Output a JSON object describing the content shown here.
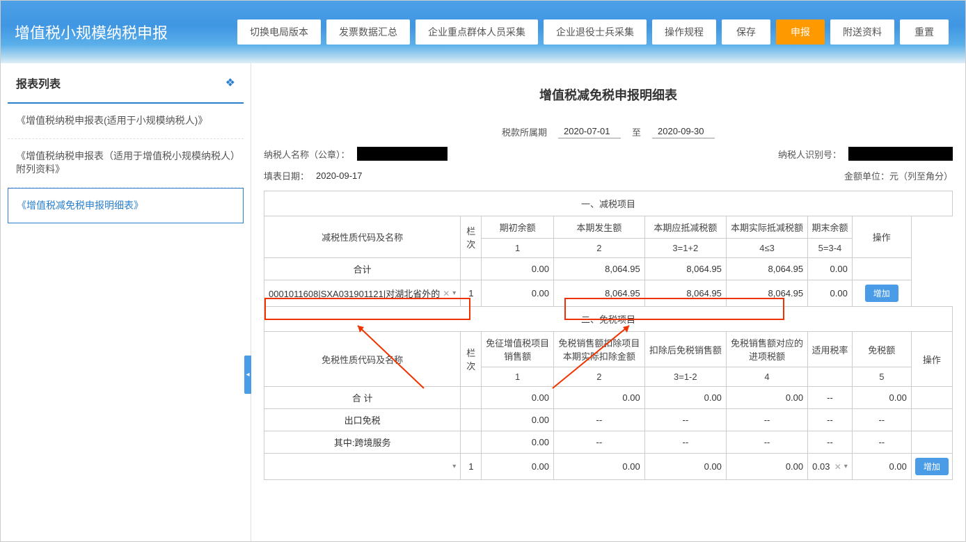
{
  "app": {
    "title": "增值税小规模纳税申报"
  },
  "toolbar": {
    "switch_version": "切换电局版本",
    "invoice_summary": "发票数据汇总",
    "key_groups": "企业重点群体人员采集",
    "retired_soldier": "企业退役士兵采集",
    "procedure": "操作规程",
    "save": "保存",
    "declare": "申报",
    "attachments": "附送资料",
    "reset": "重置"
  },
  "sidebar": {
    "title": "报表列表",
    "items": [
      {
        "label": "《增值税纳税申报表(适用于小规模纳税人)》"
      },
      {
        "label": "《增值税纳税申报表（适用于增值税小规模纳税人）附列资料》"
      },
      {
        "label": "《增值税减免税申报明细表》"
      }
    ]
  },
  "page": {
    "title": "增值税减免税申报明细表",
    "period_label": "税款所属期",
    "period_from": "2020-07-01",
    "period_sep": "至",
    "period_to": "2020-09-30",
    "taxpayer_name_label": "纳税人名称（公章）：",
    "taxpayer_id_label": "纳税人识别号：",
    "fill_date_label": "填表日期：",
    "fill_date": "2020-09-17",
    "money_unit_label": "金额单位：元（列至角分）"
  },
  "table1": {
    "section": "一、减税项目",
    "h_code_name": "减税性质代码及名称",
    "h_col": "栏次",
    "h_begin": "期初余额",
    "h_amount": "本期发生额",
    "h_should_deduct": "本期应抵减税额",
    "h_actual_deduct": "本期实际抵减税额",
    "h_end": "期末余额",
    "h_action": "操作",
    "sub": {
      "c1": "1",
      "c2": "2",
      "c3": "3=1+2",
      "c4": "4≤3",
      "c5": "5=3-4"
    },
    "total_label": "合计",
    "total": {
      "c1": "0.00",
      "c2": "8,064.95",
      "c3": "8,064.95",
      "c4": "8,064.95",
      "c5": "0.00"
    },
    "row1": {
      "code": "0001011608|SXA031901121|对湖北省外的",
      "seq": "1",
      "c1": "0.00",
      "c2": "8,064.95",
      "c3": "8,064.95",
      "c4": "8,064.95",
      "c5": "0.00",
      "add": "增加"
    }
  },
  "table2": {
    "section": "二、免税项目",
    "h_code_name": "免税性质代码及名称",
    "h_col": "栏次",
    "h_c1a": "免征增值税项目",
    "h_c1b": "销售额",
    "h_c2a": "免税销售额扣除项目",
    "h_c2b": "本期实际扣除金额",
    "h_c3": "扣除后免税销售额",
    "h_c4a": "免税销售额对应的",
    "h_c4b": "进项税额",
    "h_rate": "适用税率",
    "h_c5": "免税额",
    "h_action": "操作",
    "sub": {
      "c1": "1",
      "c2": "2",
      "c3": "3=1-2",
      "c4": "4",
      "c5": "5"
    },
    "total_label": "合 计",
    "export_label": "出口免税",
    "cross_border_label": "其中:跨境服务",
    "total": {
      "c1": "0.00",
      "c2": "0.00",
      "c3": "0.00",
      "c4": "0.00",
      "rate": "--",
      "c5": "0.00"
    },
    "export": {
      "c1": "0.00",
      "c2": "--",
      "c3": "--",
      "c4": "--",
      "rate": "--",
      "c5": "--"
    },
    "cb": {
      "c1": "0.00",
      "c2": "--",
      "c3": "--",
      "c4": "--",
      "rate": "--",
      "c5": "--"
    },
    "row1": {
      "seq": "1",
      "c1": "0.00",
      "c2": "0.00",
      "c3": "0.00",
      "c4": "0.00",
      "rate": "0.03",
      "c5": "0.00",
      "add": "增加"
    }
  }
}
